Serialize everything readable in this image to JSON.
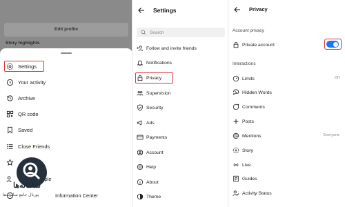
{
  "profile_bg": {
    "edit_profile": "Edit profile",
    "story_highlights": "Story highlights"
  },
  "sheet": {
    "items": [
      {
        "label": "Settings",
        "icon": "gear-icon"
      },
      {
        "label": "Your activity",
        "icon": "activity-icon"
      },
      {
        "label": "Archive",
        "icon": "archive-icon"
      },
      {
        "label": "QR code",
        "icon": "qr-code-icon"
      },
      {
        "label": "Saved",
        "icon": "bookmark-icon"
      },
      {
        "label": "Close Friends",
        "icon": "list-icon"
      },
      {
        "label": "people",
        "icon": "people-icon"
      },
      {
        "label": "Information Center",
        "icon": "info-center-icon"
      }
    ]
  },
  "watermark": {
    "name": "سامانه‌ها",
    "sub": "پورتال جامع سامانه‌ها"
  },
  "settings": {
    "title": "Settings",
    "search_placeholder": "Search",
    "items": [
      {
        "label": "Follow and invite friends",
        "icon": "add-person-icon"
      },
      {
        "label": "Notifications",
        "icon": "bell-icon"
      },
      {
        "label": "Privacy",
        "icon": "lock-icon"
      },
      {
        "label": "Supervision",
        "icon": "supervision-icon"
      },
      {
        "label": "Security",
        "icon": "shield-icon"
      },
      {
        "label": "Ads",
        "icon": "megaphone-icon"
      },
      {
        "label": "Payments",
        "icon": "card-icon"
      },
      {
        "label": "Account",
        "icon": "account-icon"
      },
      {
        "label": "Help",
        "icon": "help-icon"
      },
      {
        "label": "About",
        "icon": "info-icon"
      },
      {
        "label": "Theme",
        "icon": "theme-icon"
      }
    ]
  },
  "privacy": {
    "title": "Privacy",
    "account_privacy": "Account privacy",
    "private_account": "Private account",
    "private_account_on": true,
    "interactions": "Interactions",
    "items": [
      {
        "label": "Limits",
        "value": "Off",
        "icon": "limits-icon"
      },
      {
        "label": "Hidden Words",
        "value": "",
        "icon": "hidden-words-icon"
      },
      {
        "label": "Comments",
        "value": "",
        "icon": "comment-icon"
      },
      {
        "label": "Posts",
        "value": "",
        "icon": "posts-icon"
      },
      {
        "label": "Mentions",
        "value": "Everyone",
        "icon": "mention-icon"
      },
      {
        "label": "Story",
        "value": "",
        "icon": "story-icon"
      },
      {
        "label": "Live",
        "value": "",
        "icon": "live-icon"
      },
      {
        "label": "Guides",
        "value": "",
        "icon": "guides-icon"
      },
      {
        "label": "Activity Status",
        "value": "",
        "icon": "activity-status-icon"
      }
    ]
  },
  "colors": {
    "highlight": "#e0313b",
    "toggle_on": "#1877f2"
  }
}
